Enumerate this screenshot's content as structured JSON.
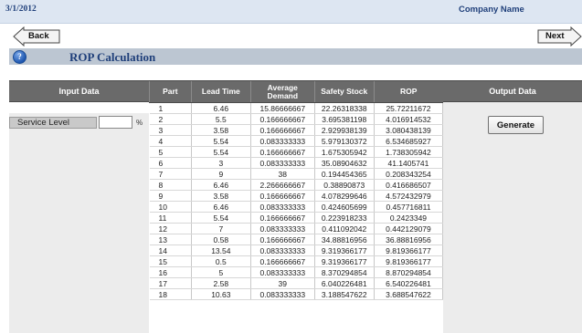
{
  "header": {
    "date": "3/1/2012",
    "company": "Company Name"
  },
  "nav": {
    "back_label": "Back",
    "next_label": "Next"
  },
  "page": {
    "help_glyph": "?",
    "title": "ROP Calculation"
  },
  "input_panel": {
    "heading": "Input Data",
    "service_level_label": "Service Level",
    "service_level_value": "",
    "unit": "%"
  },
  "output_panel": {
    "heading": "Output Data",
    "generate_label": "Generate"
  },
  "table": {
    "columns": [
      "Part",
      "Lead Time",
      "Average Demand",
      "Safety Stock",
      "ROP"
    ],
    "rows": [
      [
        "1",
        "6.46",
        "15.86666667",
        "22.26318338",
        "25.72211672"
      ],
      [
        "2",
        "5.5",
        "0.166666667",
        "3.695381198",
        "4.016914532"
      ],
      [
        "3",
        "3.58",
        "0.166666667",
        "2.929938139",
        "3.080438139"
      ],
      [
        "4",
        "5.54",
        "0.083333333",
        "5.979130372",
        "6.534685927"
      ],
      [
        "5",
        "5.54",
        "0.166666667",
        "1.675305942",
        "1.738305942"
      ],
      [
        "6",
        "3",
        "0.083333333",
        "35.08904632",
        "41.1405741"
      ],
      [
        "7",
        "9",
        "38",
        "0.194454365",
        "0.208343254"
      ],
      [
        "8",
        "6.46",
        "2.266666667",
        "0.38890873",
        "0.416686507"
      ],
      [
        "9",
        "3.58",
        "0.166666667",
        "4.078299646",
        "4.572432979"
      ],
      [
        "10",
        "6.46",
        "0.083333333",
        "0.424605699",
        "0.457716811"
      ],
      [
        "11",
        "5.54",
        "0.166666667",
        "0.223918233",
        "0.2423349"
      ],
      [
        "12",
        "7",
        "0.083333333",
        "0.411092042",
        "0.442129079"
      ],
      [
        "13",
        "0.58",
        "0.166666667",
        "34.88816956",
        "36.88816956"
      ],
      [
        "14",
        "13.54",
        "0.083333333",
        "9.319366177",
        "9.819366177"
      ],
      [
        "15",
        "0.5",
        "0.166666667",
        "9.319366177",
        "9.819366177"
      ],
      [
        "16",
        "5",
        "0.083333333",
        "8.370294854",
        "8.870294854"
      ],
      [
        "17",
        "2.58",
        "39",
        "6.040226481",
        "6.540226481"
      ],
      [
        "18",
        "10.63",
        "0.083333333",
        "3.188547622",
        "3.688547622"
      ]
    ]
  }
}
